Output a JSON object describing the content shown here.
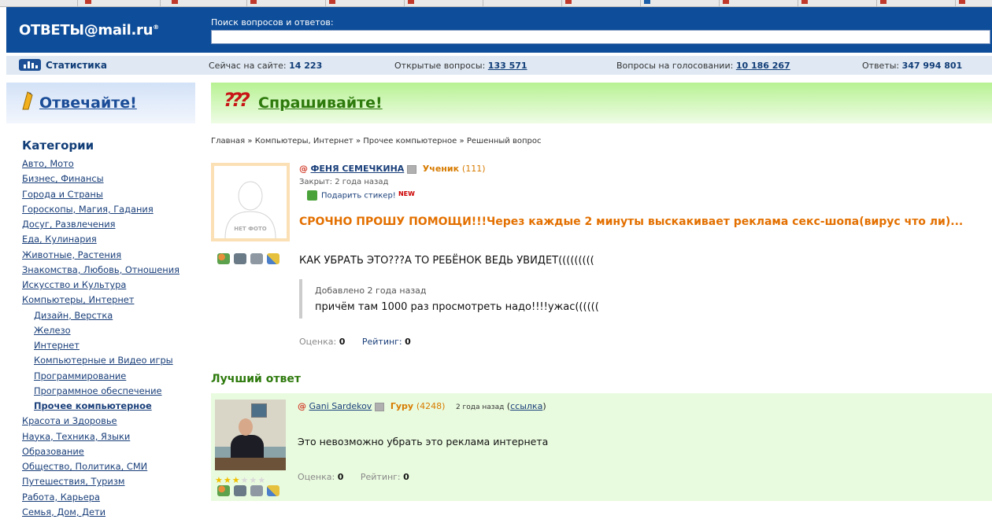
{
  "header": {
    "logo": "ОТВЕТЫ@mail.ru",
    "logo_mark": "®",
    "search_label": "Поиск вопросов и ответов:",
    "search_value": ""
  },
  "stats": {
    "label": "Статистика",
    "online_label": "Сейчас на сайте:",
    "online_value": "14 223",
    "open_label": "Открытые вопросы:",
    "open_value": "133 571",
    "voting_label": "Вопросы на голосовании:",
    "voting_value": "10 186 267",
    "answers_label": "Ответы:",
    "answers_value": "347 994 801"
  },
  "promo": {
    "answer_label": "Отвечайте!",
    "ask_label": "Спрашивайте!"
  },
  "sidebar": {
    "title": "Категории",
    "items": [
      {
        "label": "Авто, Мото"
      },
      {
        "label": "Бизнес, Финансы"
      },
      {
        "label": "Города и Страны"
      },
      {
        "label": "Гороскопы, Магия, Гадания"
      },
      {
        "label": "Досуг, Развлечения"
      },
      {
        "label": "Еда, Кулинария"
      },
      {
        "label": "Животные, Растения"
      },
      {
        "label": "Знакомства, Любовь, Отношения"
      },
      {
        "label": "Искусство и Культура"
      },
      {
        "label": "Компьютеры, Интернет"
      },
      {
        "label": "Дизайн, Верстка",
        "sub": true
      },
      {
        "label": "Железо",
        "sub": true
      },
      {
        "label": "Интернет",
        "sub": true
      },
      {
        "label": "Компьютерные и Видео игры",
        "sub": true
      },
      {
        "label": "Программирование",
        "sub": true
      },
      {
        "label": "Программное обеспечение",
        "sub": true
      },
      {
        "label": "Прочее компьютерное",
        "sub": true,
        "current": true
      },
      {
        "label": "Красота и Здоровье"
      },
      {
        "label": "Наука, Техника, Языки"
      },
      {
        "label": "Образование"
      },
      {
        "label": "Общество, Политика, СМИ"
      },
      {
        "label": "Путешествия, Туризм"
      },
      {
        "label": "Работа, Карьера"
      },
      {
        "label": "Семья, Дом, Дети"
      }
    ]
  },
  "breadcrumb": {
    "home": "Главная",
    "section": "Компьютеры, Интернет",
    "subsection": "Прочее компьютерное",
    "current": "Решенный вопрос",
    "sep": "»"
  },
  "question": {
    "no_photo": "НЕТ ФОТО",
    "author": "ФЕНЯ СЕМЕЧКИНА",
    "rank": "Ученик",
    "points": "(111)",
    "closed": "Закрыт: 2 года назад",
    "sticker_label": "Подарить стикер!",
    "sticker_badge": "NEW",
    "title": "СРОЧНО ПРОШУ ПОМОЩИ!!!Через каждые 2 минуты выскакивает реклама секс-шопа(вирус что ли)...",
    "text": "КАК УБРАТЬ ЭТО???А ТО РЕБЁНОК ВЕДЬ УВИДЕТ(((((((((",
    "added_label": "Добавлено 2 года назад",
    "added_text": "причём там 1000 раз просмотреть надо!!!!ужас((((((",
    "score_label": "Оценка:",
    "score_value": "0",
    "rating_label": "Рейтинг:",
    "rating_value": "0"
  },
  "best_answer": {
    "title": "Лучший ответ",
    "author": "Gani Sardekov",
    "rank": "Гуру",
    "points": "(4248)",
    "time": "2 года назад",
    "link_label": "ссылка",
    "stars_filled": 3,
    "stars_total": 6,
    "text": "Это невозможно убрать это реклама интернета",
    "score_label": "Оценка:",
    "score_value": "0",
    "rating_label": "Рейтинг:",
    "rating_value": "0"
  },
  "colors": {
    "header_bg": "#0e4d99",
    "question_title": "#e37000",
    "best_answer_bg": "#e9fbdf",
    "ask_green": "#2e7a0d"
  }
}
